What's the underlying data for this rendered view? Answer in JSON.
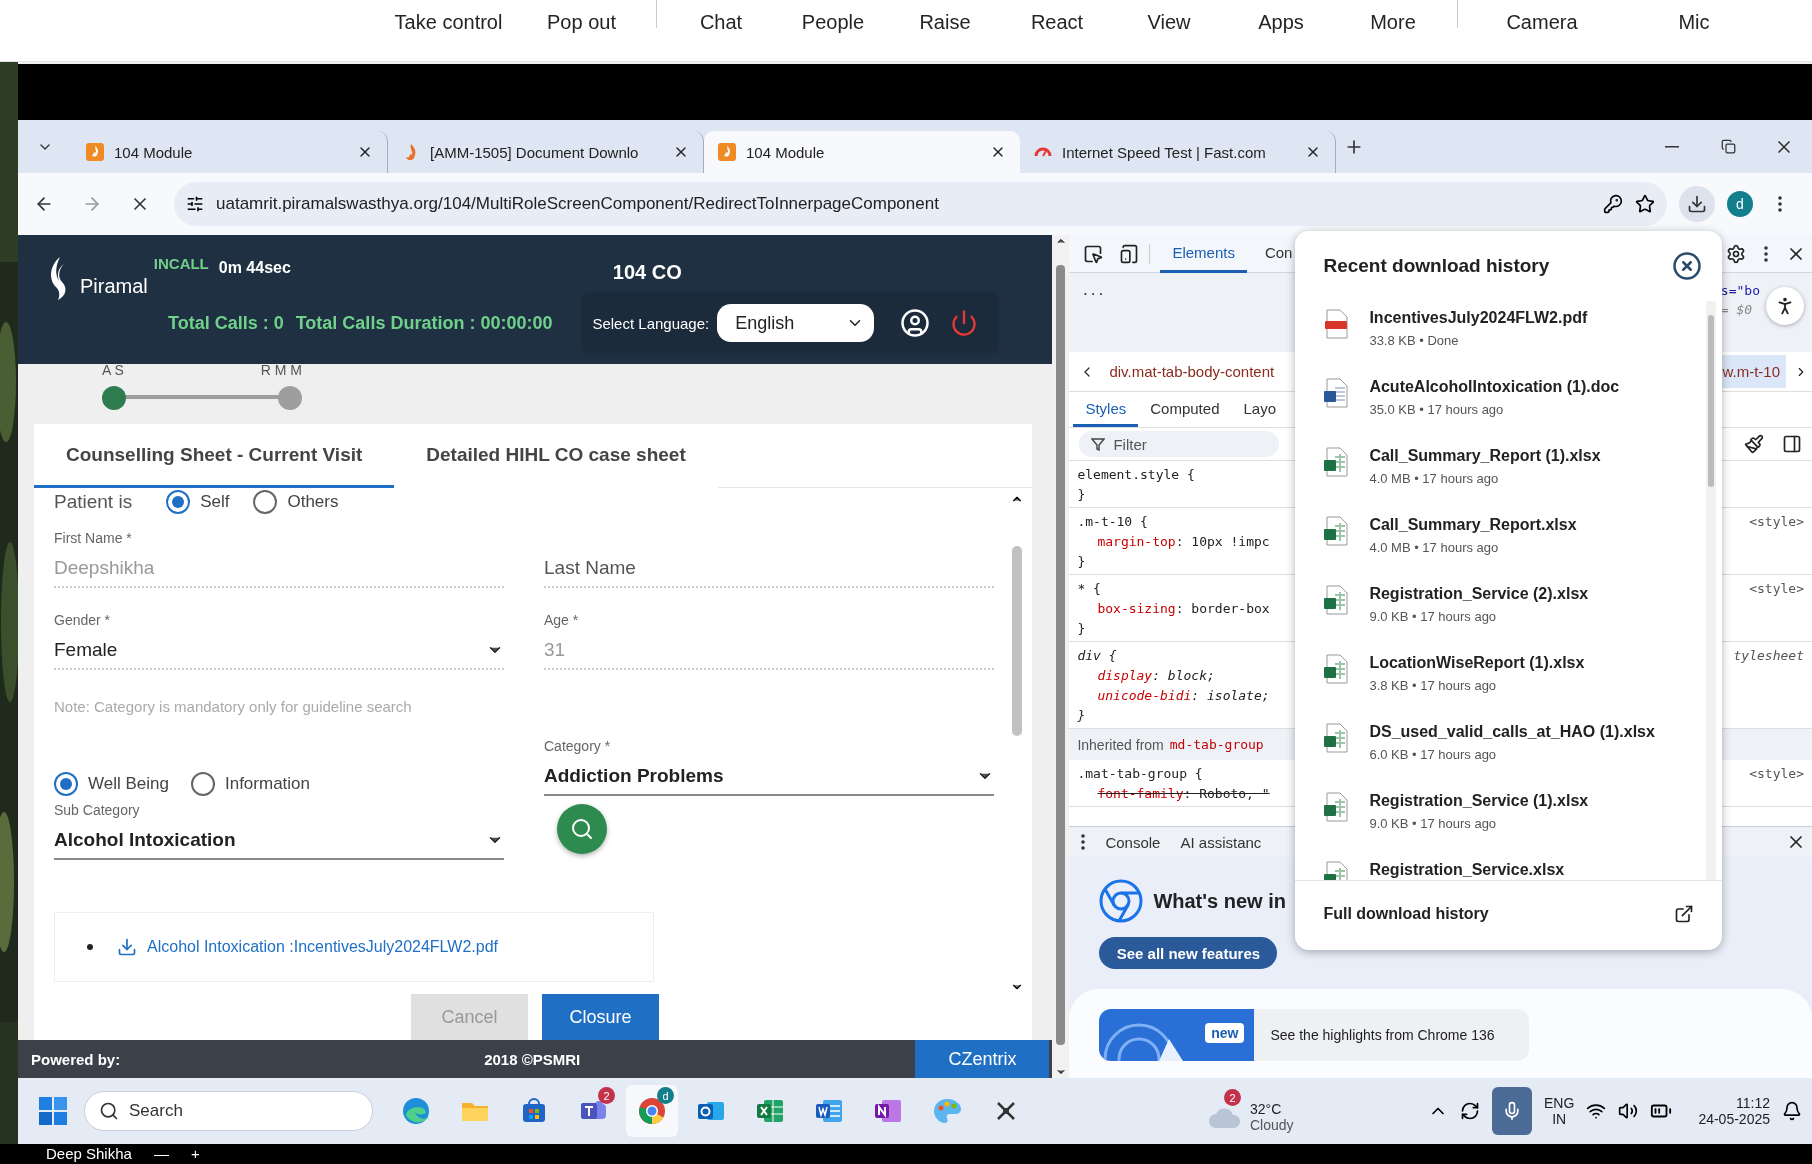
{
  "meeting_toolbar": {
    "actions": [
      "Take control",
      "Pop out",
      "Chat",
      "People",
      "Raise",
      "React",
      "View",
      "Apps",
      "More",
      "Camera",
      "Mic"
    ]
  },
  "browser": {
    "tabs": [
      {
        "title": "104 Module",
        "selected": false,
        "kind": "module"
      },
      {
        "title": "[AMM-1505] Document Downlo",
        "selected": false,
        "kind": "flame"
      },
      {
        "title": "104 Module",
        "selected": true,
        "kind": "module"
      },
      {
        "title": "Internet Speed Test | Fast.com",
        "selected": false,
        "kind": "gauge"
      }
    ],
    "url": "uatamrit.piramalswasthya.org/104/MultiRoleScreenComponent/RedirectToInnerpageComponent",
    "profile": "d"
  },
  "app": {
    "logo": "Piramal",
    "call_status": "INCALL",
    "call_time": "0m 44sec",
    "role": "104 CO",
    "total_calls": "Total Calls : 0",
    "total_duration": "Total Calls Duration : 00:00:00",
    "language_label": "Select Language:",
    "language": "English",
    "steps": [
      {
        "label": "A S",
        "done": true
      },
      {
        "label": "R M M",
        "done": false
      }
    ],
    "tabs": [
      {
        "label": "Counselling Sheet - Current Visit",
        "selected": true
      },
      {
        "label": "Detailed HIHL CO case sheet",
        "selected": false
      }
    ],
    "form": {
      "patient_label": "Patient is",
      "patient_options": [
        {
          "label": "Self",
          "selected": true
        },
        {
          "label": "Others",
          "selected": false
        }
      ],
      "first_name": {
        "label": "First Name *",
        "value": "Deepshikha",
        "disabled": true
      },
      "last_name": {
        "placeholder": "Last Name"
      },
      "gender": {
        "label": "Gender *",
        "value": "Female"
      },
      "age": {
        "label": "Age *",
        "value": "31",
        "disabled": true
      },
      "note": "Note: Category is mandatory only for guideline search",
      "type_options": [
        {
          "label": "Well Being",
          "selected": true
        },
        {
          "label": "Information",
          "selected": false
        }
      ],
      "category": {
        "label": "Category *",
        "value": "Addiction Problems"
      },
      "sub_category": {
        "label": "Sub Category",
        "value": "Alcohol Intoxication"
      },
      "documents": [
        "Alcohol Intoxication :IncentivesJuly2024FLW2.pdf"
      ],
      "buttons": [
        {
          "label": "Cancel",
          "disabled": true
        },
        {
          "label": "Closure",
          "disabled": false
        }
      ]
    },
    "footer": {
      "powered_by": "Powered by:",
      "copyright": "2018 ©PSMRI",
      "vendor": "CZentrix"
    }
  },
  "devtools": {
    "tabs": [
      {
        "label": "Elements",
        "selected": true
      },
      {
        "label": "Con",
        "selected": false
      }
    ],
    "dom_fragments": [
      "s=\"bo",
      "= $0"
    ],
    "dom_ellipsis": "...",
    "breadcrumb": "div.mat-tab-body-content",
    "breadcrumb_right": "w.m-t-10",
    "style_tabs": [
      {
        "label": "Styles",
        "selected": true
      },
      {
        "label": "Computed",
        "selected": false
      },
      {
        "label": "Layo",
        "selected": false
      }
    ],
    "filter_placeholder": "Filter",
    "rules": [
      {
        "kind": "rule",
        "selector": "element.style {",
        "italic": false,
        "close": "}"
      },
      {
        "kind": "rule",
        "selector": ".m-t-10 {",
        "italic": false,
        "declarations": [
          {
            "property": "margin-top",
            "value": ": 10px !impc",
            "struck": false
          }
        ],
        "close": "}",
        "source": "<style>"
      },
      {
        "kind": "rule",
        "selector": "* {",
        "italic": false,
        "declarations": [
          {
            "property": "box-sizing",
            "value": ": border-box",
            "struck": false
          }
        ],
        "close": "}",
        "source": "<style>"
      },
      {
        "kind": "rule",
        "selector": "div {",
        "italic": true,
        "declarations": [
          {
            "property": "display",
            "value": ": block;",
            "struck": false
          },
          {
            "property": "unicode-bidi",
            "value": ": isolate;",
            "struck": false
          }
        ],
        "close": "}",
        "source": "tylesheet"
      },
      {
        "kind": "inherited",
        "label": "Inherited from",
        "from": "md-tab-group"
      },
      {
        "kind": "rule",
        "selector": ".mat-tab-group {",
        "italic": false,
        "declarations": [
          {
            "property": "font-family",
            "value": ": Roboto, \"",
            "struck": true
          }
        ],
        "source": "<style>"
      }
    ],
    "drawer": {
      "tabs": [
        "Console",
        "AI assistanc"
      ],
      "whats_new": "What's new in",
      "features_button": "See all new features",
      "badge": "new",
      "highlight": "See the highlights from Chrome 136"
    }
  },
  "downloads": {
    "title": "Recent download history",
    "items": [
      {
        "name": "IncentivesJuly2024FLW2.pdf",
        "meta": "33.8 KB • Done",
        "kind": "pdf"
      },
      {
        "name": "AcuteAlcoholIntoxication (1).doc",
        "meta": "35.0 KB • 17 hours ago",
        "kind": "doc"
      },
      {
        "name": "Call_Summary_Report (1).xlsx",
        "meta": "4.0 MB • 17 hours ago",
        "kind": "xlsx"
      },
      {
        "name": "Call_Summary_Report.xlsx",
        "meta": "4.0 MB • 17 hours ago",
        "kind": "xlsx"
      },
      {
        "name": "Registration_Service (2).xlsx",
        "meta": "9.0 KB • 17 hours ago",
        "kind": "xlsx"
      },
      {
        "name": "LocationWiseReport (1).xlsx",
        "meta": "3.8 KB • 17 hours ago",
        "kind": "xlsx"
      },
      {
        "name": "DS_used_valid_calls_at_HAO (1).xlsx",
        "meta": "6.0 KB • 17 hours ago",
        "kind": "xlsx"
      },
      {
        "name": "Registration_Service (1).xlsx",
        "meta": "9.0 KB • 17 hours ago",
        "kind": "xlsx"
      },
      {
        "name": "Registration_Service.xlsx",
        "kind": "xlsx"
      }
    ],
    "footer": "Full download history"
  },
  "taskbar": {
    "search_placeholder": "Search",
    "apps": [
      {
        "kind": "edge",
        "active": false
      },
      {
        "kind": "folder",
        "active": false
      },
      {
        "kind": "store",
        "active": false
      },
      {
        "kind": "teams",
        "active": false,
        "badge": "2"
      },
      {
        "kind": "chrome",
        "active": true,
        "badge": "d"
      },
      {
        "kind": "outlook",
        "active": false
      },
      {
        "kind": "excel",
        "active": false
      },
      {
        "kind": "word",
        "active": false
      },
      {
        "kind": "onenote",
        "active": false
      },
      {
        "kind": "paint",
        "active": false
      },
      {
        "kind": "tool",
        "active": false
      }
    ],
    "weather": {
      "badge": "2",
      "temperature": "32°C",
      "condition": "Cloudy"
    },
    "language": "ENG",
    "region": "IN",
    "time": "11:12",
    "date": "24-05-2025"
  },
  "bottom_bar": {
    "name": "Deep Shikha",
    "buttons": [
      "—",
      "+"
    ]
  }
}
